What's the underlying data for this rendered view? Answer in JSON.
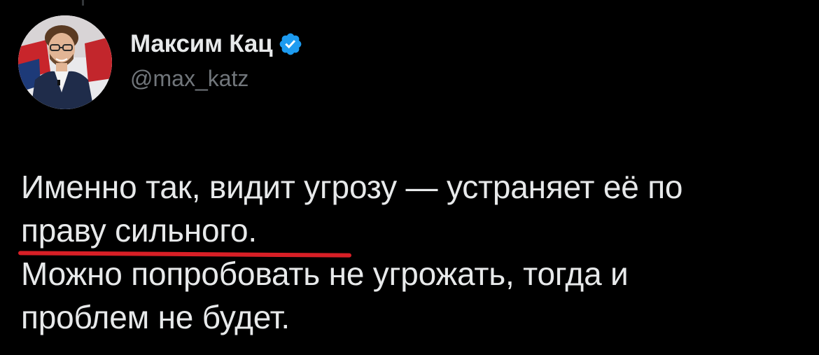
{
  "author": {
    "display_name": "Максим Кац",
    "handle": "@max_katz",
    "verified": true,
    "verified_color": "#1d9bf0"
  },
  "tweet": {
    "lines": [
      "Именно так, видит угрозу — устраняет её по",
      "праву сильного.",
      "Можно попробовать не угрожать, тогда и",
      "проблем не будет."
    ],
    "highlight_color": "#d81f26"
  },
  "icons": {
    "verified": "verified-badge-icon",
    "avatar": "profile-photo"
  },
  "colors": {
    "background": "#000000",
    "text": "#e7e9ea",
    "secondary_text": "#71767b"
  }
}
